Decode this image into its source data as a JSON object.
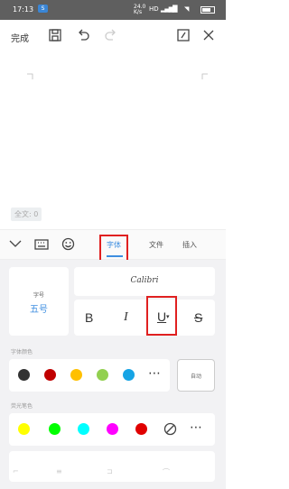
{
  "status_bar": {
    "time": "17:13",
    "app_badge": "S",
    "net_speed": "24.0\nK/s",
    "network_type": "HD",
    "signal": "4G",
    "wifi": "wifi-icon"
  },
  "toolbar": {
    "done_label": "完成",
    "save_icon": "save-icon",
    "undo_icon": "undo-icon",
    "redo_icon": "redo-icon",
    "page_icon": "page-icon",
    "collapse_icon": "chevron-down-icon"
  },
  "editor": {
    "word_count": "全文: 0"
  },
  "format_tabs": {
    "tabs": [
      "字体",
      "文件",
      "插入"
    ],
    "active": "字体"
  },
  "font_panel": {
    "font_size_label": "字号",
    "font_size_value": "五号",
    "font_name": "Calibri",
    "style_buttons": [
      "B",
      "I",
      "U",
      "S"
    ]
  },
  "font_color": {
    "label": "字体颜色",
    "colors": [
      "#333333",
      "#c00000",
      "#ffc000",
      "#92d050",
      "#16a4e5"
    ],
    "more_label": "⋯",
    "custom_label": "自动"
  },
  "highlight": {
    "label": "荧光笔色",
    "colors": [
      "#ffff00",
      "#00ff00",
      "#00ffff",
      "#ff00ff",
      "#e00000"
    ],
    "none_icon": "no-color-icon",
    "more_label": "⋯"
  }
}
